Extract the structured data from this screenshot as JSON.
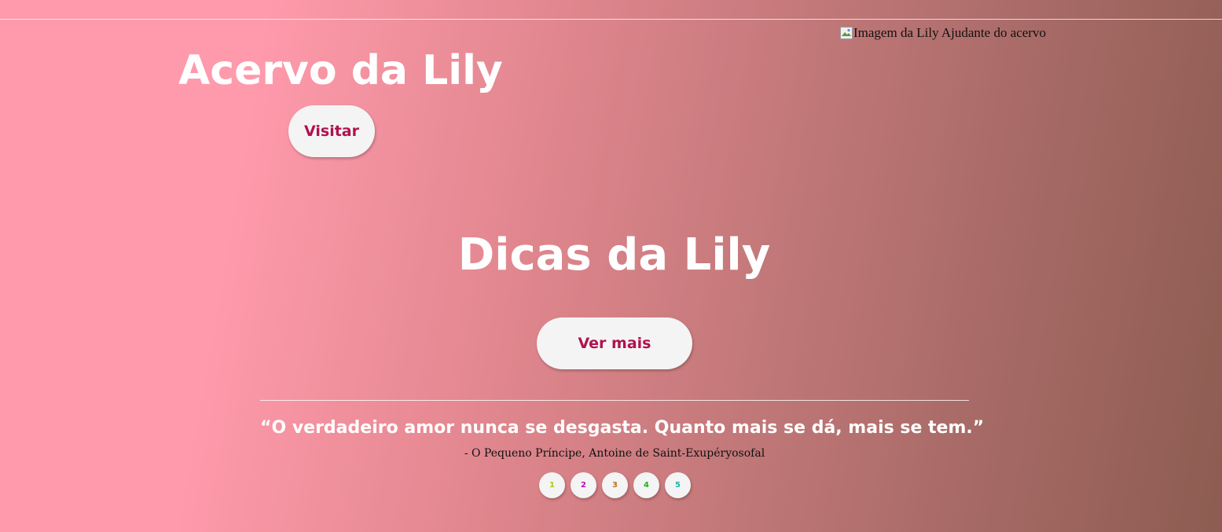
{
  "header": {
    "image_alt": "Imagem da Lily Ajudante do acervo"
  },
  "hero": {
    "title": "Acervo da Lily",
    "visit_label": "Visitar"
  },
  "tips": {
    "title": "Dicas da Lily",
    "more_label": "Ver mais"
  },
  "quote": {
    "text": "“O verdadeiro amor nunca se desgasta. Quanto mais se dá, mais se tem.”",
    "author": "- O Pequeno Príncipe, Antoine de Saint-Exupéryosofal"
  },
  "pager": {
    "pages": [
      {
        "label": "1",
        "color": "#b5c21a"
      },
      {
        "label": "2",
        "color": "#b012b0"
      },
      {
        "label": "3",
        "color": "#b8741a"
      },
      {
        "label": "4",
        "color": "#1ab51a"
      },
      {
        "label": "5",
        "color": "#1ab5a8"
      }
    ]
  },
  "colors": {
    "accent": "#b0124d",
    "button_bg": "#f4f4f4",
    "gradient_start": "#ff9aac",
    "gradient_end": "#8d5c51"
  }
}
